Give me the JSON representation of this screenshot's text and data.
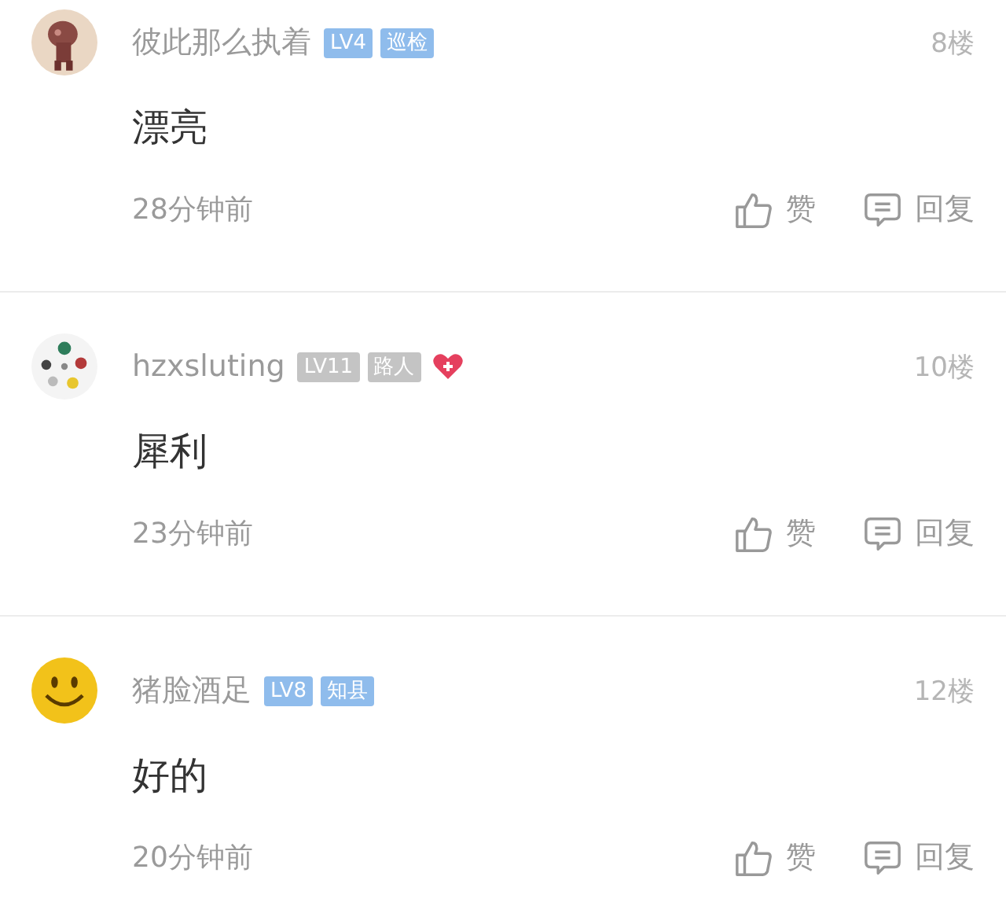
{
  "comments": [
    {
      "avatar": {
        "kind": "picture"
      },
      "username": "彼此那么执着",
      "badges": [
        {
          "label": "LV4",
          "color": "#8fbcec"
        },
        {
          "label": "巡检",
          "color": "#8fbcec"
        }
      ],
      "heart": false,
      "floor": "8楼",
      "content": "漂亮",
      "time": "28分钟前",
      "like_label": "赞",
      "reply_label": "回复"
    },
    {
      "avatar": {
        "kind": "dots"
      },
      "username": "hzxsluting",
      "badges": [
        {
          "label": "LV11",
          "color": "#c4c4c4"
        },
        {
          "label": "路人",
          "color": "#c4c4c4"
        }
      ],
      "heart": true,
      "floor": "10楼",
      "content": "犀利",
      "time": "23分钟前",
      "like_label": "赞",
      "reply_label": "回复"
    },
    {
      "avatar": {
        "kind": "smiley"
      },
      "username": "猪脸酒足",
      "badges": [
        {
          "label": "LV8",
          "color": "#8fbcec"
        },
        {
          "label": "知县",
          "color": "#8fbcec"
        }
      ],
      "heart": false,
      "floor": "12楼",
      "content": "好的",
      "time": "20分钟前",
      "like_label": "赞",
      "reply_label": "回复"
    }
  ]
}
